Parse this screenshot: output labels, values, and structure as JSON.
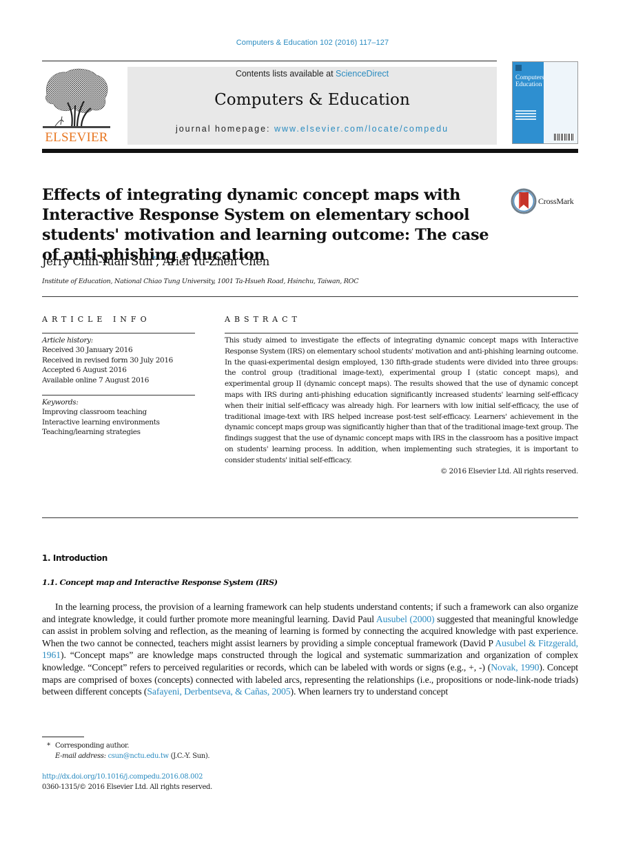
{
  "header": {
    "journal_ref": "Computers & Education 102 (2016) 117–127",
    "contents_prefix": "Contents lists available at ",
    "contents_link": "ScienceDirect",
    "journal_title": "Computers & Education",
    "homepage_prefix": "journal homepage: ",
    "homepage_link": "www.elsevier.com/locate/compedu",
    "publisher_logo_text": "ELSEVIER",
    "cover_title_line1": "Computers",
    "cover_title_amp": "&",
    "cover_title_line2": "Education",
    "colors": {
      "link": "#2a8bc0",
      "elsevier_orange": "#e87722",
      "cover_blue": "#2e8fd0",
      "masthead_bg": "#e8e8e8"
    }
  },
  "article": {
    "title": "Effects of integrating dynamic concept maps with Interactive Response System on elementary school students' motivation and learning outcome: The case of anti-phishing education",
    "crossmark_label": "CrossMark",
    "authors": [
      {
        "name": "Jerry Chih-Yuan Sun",
        "marker": "*"
      },
      {
        "name": "Ariel Yu-Zhen Chen",
        "marker": ""
      }
    ],
    "author_separator": ", ",
    "affiliation": "Institute of Education, National Chiao Tung University, 1001 Ta-Hsueh Road, Hsinchu, Taiwan, ROC"
  },
  "article_info": {
    "heading": "ARTICLE INFO",
    "history_label": "Article history:",
    "history": [
      "Received 30 January 2016",
      "Received in revised form 30 July 2016",
      "Accepted 6 August 2016",
      "Available online 7 August 2016"
    ],
    "keywords_label": "Keywords:",
    "keywords": [
      "Improving classroom teaching",
      "Interactive learning environments",
      "Teaching/learning strategies"
    ]
  },
  "abstract": {
    "heading": "ABSTRACT",
    "text": "This study aimed to investigate the effects of integrating dynamic concept maps with Interactive Response System (IRS) on elementary school students' motivation and anti-phishing learning outcome. In the quasi-experimental design employed, 130 fifth-grade students were divided into three groups: the control group (traditional image-text), experimental group I (static concept maps), and experimental group II (dynamic concept maps). The results showed that the use of dynamic concept maps with IRS during anti-phishing education significantly increased students' learning self-efficacy when their initial self-efficacy was already high. For learners with low initial self-efficacy, the use of traditional image-text with IRS helped increase post-test self-efficacy. Learners' achievement in the dynamic concept maps group was significantly higher than that of the traditional image-text group. The findings suggest that the use of dynamic concept maps with IRS in the classroom has a positive impact on students' learning process. In addition, when implementing such strategies, it is important to consider students' initial self-efficacy.",
    "copyright": "© 2016 Elsevier Ltd. All rights reserved."
  },
  "body": {
    "section_heading": "1.  Introduction",
    "subsection_heading": "1.1.  Concept map and Interactive Response System (IRS)",
    "paragraph_parts": [
      {
        "t": "In the learning process, the provision of a learning framework can help students understand contents; if such a framework can also organize and integrate knowledge, it could further promote more meaningful learning. David Paul "
      },
      {
        "link": "Ausubel (2000)"
      },
      {
        "t": " suggested that meaningful knowledge can assist in problem solving and reflection, as the meaning of learning is formed by connecting the acquired knowledge with past experience. When the two cannot be connected, teachers might assist learners by providing a simple conceptual framework (David P "
      },
      {
        "link": "Ausubel & Fitzgerald, 1961"
      },
      {
        "t": "). “Concept maps” are knowledge maps constructed through the logical and systematic summarization and organization of complex knowledge. “Concept” refers to perceived regularities or records, which can be labeled with words or signs (e.g., +, -) ("
      },
      {
        "link": "Novak, 1990"
      },
      {
        "t": "). Concept maps are comprised of boxes (concepts) connected with labeled arcs, representing the relationships (i.e., propositions or node-link-node triads) between different concepts ("
      },
      {
        "link": "Safayeni, Derbentseva, & Cañas, 2005"
      },
      {
        "t": "). When learners try to understand concept"
      }
    ]
  },
  "footnotes": {
    "star": "*",
    "corresponding": "Corresponding author.",
    "email_label": "E-mail address: ",
    "email": "csun@nctu.edu.tw",
    "email_suffix": " (J.C.-Y. Sun).",
    "doi": "http://dx.doi.org/10.1016/j.compedu.2016.08.002",
    "issn_copyright": "0360-1315/© 2016 Elsevier Ltd. All rights reserved."
  }
}
